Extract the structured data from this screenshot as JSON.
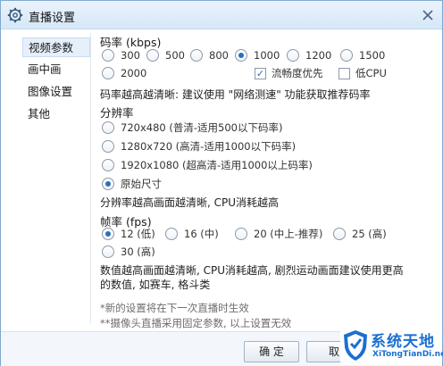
{
  "window": {
    "title": "直播设置"
  },
  "sidebar": {
    "items": [
      {
        "label": "视频参数",
        "active": true
      },
      {
        "label": "画中画",
        "active": false
      },
      {
        "label": "图像设置",
        "active": false
      },
      {
        "label": "其他",
        "active": false
      }
    ]
  },
  "bitrate": {
    "label": "码率 (kbps)",
    "options": [
      "300",
      "500",
      "800",
      "1000",
      "1200",
      "1500",
      "2000"
    ],
    "selected": "1000",
    "smooth_label": "流畅度优先",
    "smooth_checked": true,
    "lowcpu_label": "低CPU",
    "lowcpu_checked": false,
    "note": "码率越高越清晰: 建议使用 \"网络测速\" 功能获取推荐码率"
  },
  "resolution": {
    "label": "分辨率",
    "options": [
      "720x480 (普清-适用500以下码率)",
      "1280x720 (高清-适用1000以下码率)",
      "1920x1080 (超高清-适用1000以上码率)",
      "原始尺寸"
    ],
    "selected": "原始尺寸",
    "note": "分辨率越高画面越清晰, CPU消耗越高"
  },
  "framerate": {
    "label": "帧率 (fps)",
    "options": [
      "12 (低)",
      "16 (中)",
      "20 (中上-推荐)",
      "25 (高)",
      "30 (高)"
    ],
    "selected": "12 (低)",
    "note_line1": "数值越高画面越清晰, CPU消耗越高, 剧烈运动画面建议使用更高",
    "note_line2": "的数值, 如赛车, 格斗类"
  },
  "hints": {
    "line1": "*新的设置将在下一次直播时生效",
    "line2": "**摄像头直播采用固定参数, 以上设置无效"
  },
  "footer": {
    "ok_label": "确 定",
    "cancel_label": "取"
  },
  "watermark": {
    "title": "系统天地",
    "url": "XiTongTianDi.net"
  },
  "colors": {
    "accent": "#2a6fbf",
    "titlebar": "#d6e7f7",
    "watermark": "#1b6fd1"
  }
}
